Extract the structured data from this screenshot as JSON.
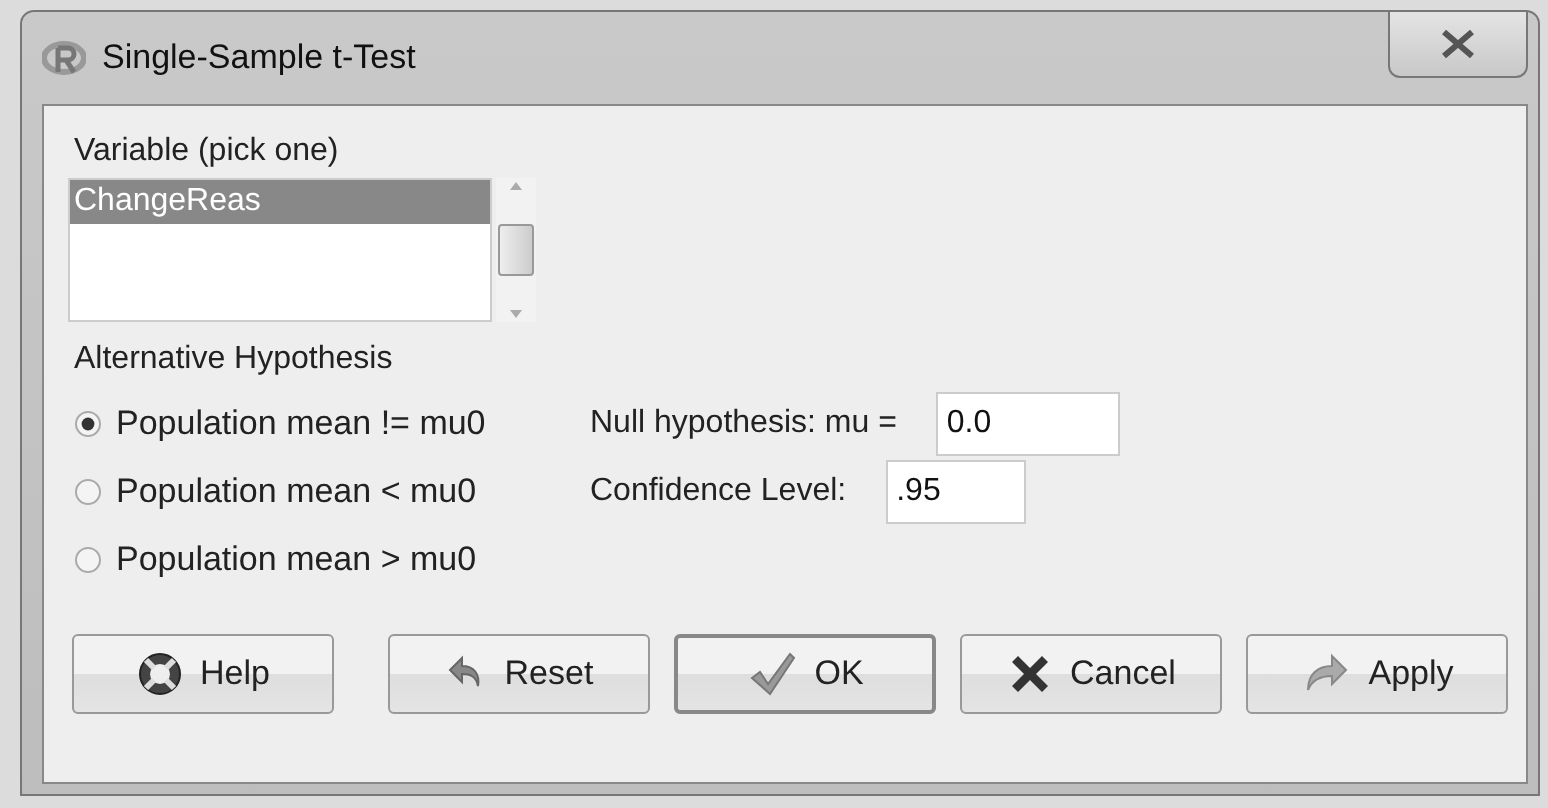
{
  "window": {
    "title": "Single-Sample t-Test"
  },
  "variable": {
    "label": "Variable (pick one)",
    "items": [
      {
        "label": "ChangeReas",
        "selected": true
      }
    ]
  },
  "alternative": {
    "label": "Alternative Hypothesis",
    "options": [
      {
        "label": "Population mean != mu0",
        "selected": true
      },
      {
        "label": "Population mean < mu0",
        "selected": false
      },
      {
        "label": "Population mean > mu0",
        "selected": false
      }
    ]
  },
  "fields": [
    {
      "label": "Null hypothesis: mu =",
      "value": "0.0"
    },
    {
      "label": "Confidence Level:",
      "value": ".95"
    }
  ],
  "buttons": [
    {
      "label": "Help",
      "kind": "help",
      "default": false
    },
    {
      "label": "Reset",
      "kind": "reset",
      "default": false
    },
    {
      "label": "OK",
      "kind": "ok",
      "default": true
    },
    {
      "label": "Cancel",
      "kind": "cancel",
      "default": false
    },
    {
      "label": "Apply",
      "kind": "apply",
      "default": false
    }
  ]
}
